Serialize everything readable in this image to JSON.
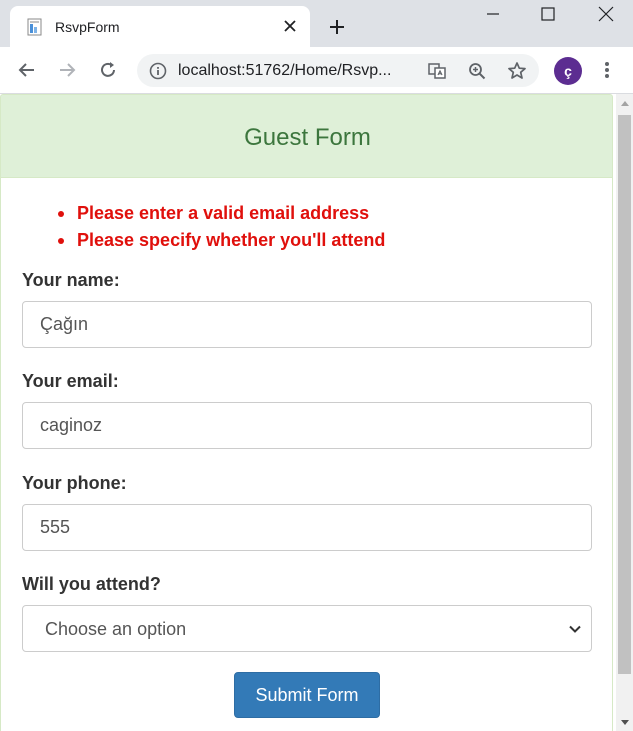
{
  "browser": {
    "tab": {
      "title": "RsvpForm"
    },
    "address_bar": {
      "url": "localhost:51762/Home/Rsvp..."
    },
    "profile_initial": "ç"
  },
  "page": {
    "heading": "Guest Form",
    "errors": [
      "Please enter a valid email address",
      "Please specify whether you'll attend"
    ],
    "fields": {
      "name": {
        "label": "Your name:",
        "value": "Çağın"
      },
      "email": {
        "label": "Your email:",
        "value": "caginoz"
      },
      "phone": {
        "label": "Your phone:",
        "value": "555"
      },
      "attend": {
        "label": "Will you attend?",
        "selected": "Choose an option"
      }
    },
    "submit_label": "Submit Form"
  },
  "colors": {
    "heading_bg": "#dff0d8",
    "heading_text": "#3c763d",
    "error_text": "#e0100c",
    "button_bg": "#337ab7",
    "avatar_bg": "#5c2d91"
  }
}
